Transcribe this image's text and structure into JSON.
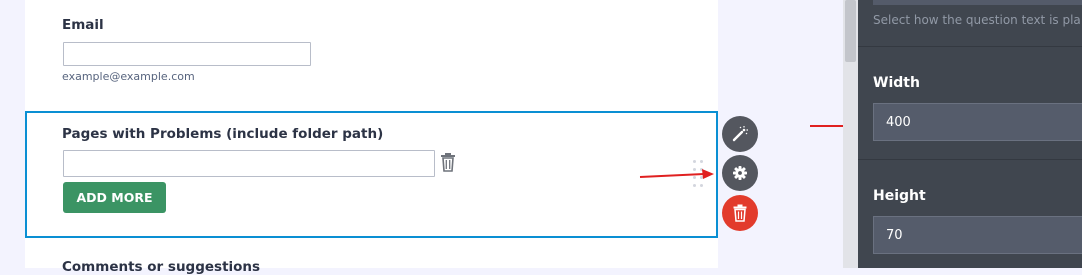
{
  "form": {
    "email": {
      "label": "Email",
      "value": "",
      "sublabel": "example@example.com"
    },
    "pages_with_problems": {
      "label": "Pages with Problems (include folder path)",
      "value": "",
      "add_more_label": "ADD MORE"
    },
    "comments": {
      "label": "Comments or suggestions"
    }
  },
  "field_actions": {
    "wand_icon": "magic-wand-icon",
    "settings_icon": "gear-icon",
    "delete_icon": "trash-icon"
  },
  "properties_panel": {
    "note": "Select how the question text is pla",
    "width": {
      "label": "Width",
      "value": "400"
    },
    "height": {
      "label": "Height",
      "value": "70"
    }
  },
  "colors": {
    "selection_border": "#0a8fd3",
    "add_more_button": "#3b9464",
    "delete_button": "#e23b2c",
    "panel_background": "#40464f",
    "annotation_arrow": "#e02020"
  }
}
